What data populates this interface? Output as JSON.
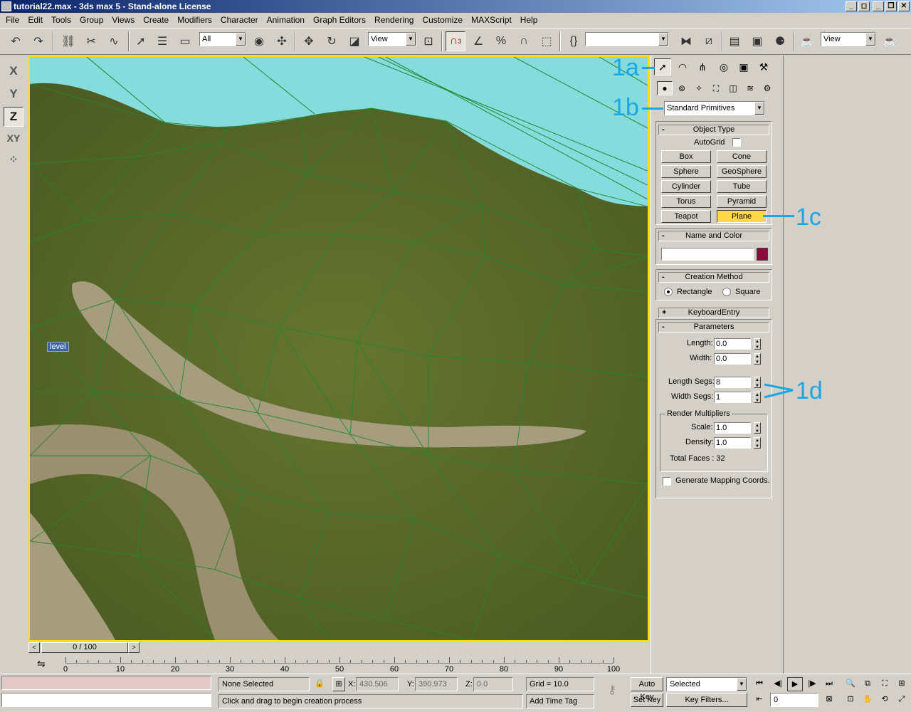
{
  "window": {
    "title": "tutorial22.max - 3ds max 5 - Stand-alone License",
    "btn_minimize": "_",
    "btn_restore1": "◻",
    "btn_min2": "_",
    "btn_restore2": "❐",
    "btn_close": "✕"
  },
  "menu": [
    "File",
    "Edit",
    "Tools",
    "Group",
    "Views",
    "Create",
    "Modifiers",
    "Character",
    "Animation",
    "Graph Editors",
    "Rendering",
    "Customize",
    "MAXScript",
    "Help"
  ],
  "toolbar": {
    "selection_filter": "All",
    "ref_coord": "View",
    "named_selection": "",
    "render_view": "View",
    "snap_label": "3"
  },
  "axis": {
    "x": "X",
    "y": "Y",
    "z": "Z",
    "xy": "XY"
  },
  "viewport": {
    "level_label": "level"
  },
  "timeslider": {
    "position": "0 / 100",
    "prev": "<",
    "next": ">"
  },
  "track_ticks": [
    "0",
    "10",
    "20",
    "30",
    "40",
    "50",
    "60",
    "70",
    "80",
    "90",
    "100"
  ],
  "command_panel": {
    "dropdown": "Standard Primitives",
    "object_type": {
      "header": "Object Type",
      "autogrid": "AutoGrid",
      "buttons": [
        "Box",
        "Cone",
        "Sphere",
        "GeoSphere",
        "Cylinder",
        "Tube",
        "Torus",
        "Pyramid",
        "Teapot",
        "Plane"
      ],
      "selected": "Plane"
    },
    "name_color": {
      "header": "Name and Color",
      "name_value": "",
      "color": "#8c0a3c"
    },
    "creation_method": {
      "header": "Creation Method",
      "rectangle": "Rectangle",
      "square": "Square",
      "selected": "Rectangle"
    },
    "keyboard_entry": {
      "header": "KeyboardEntry"
    },
    "parameters": {
      "header": "Parameters",
      "length_label": "Length:",
      "length_value": "0.0",
      "width_label": "Width:",
      "width_value": "0.0",
      "length_segs_label": "Length Segs:",
      "length_segs_value": "8",
      "width_segs_label": "Width Segs:",
      "width_segs_value": "1",
      "render_multipliers": "Render Multipliers",
      "scale_label": "Scale:",
      "scale_value": "1.0",
      "density_label": "Density:",
      "density_value": "1.0",
      "total_faces": "Total Faces : 32",
      "gen_mapping": "Generate Mapping Coords."
    },
    "minus": "-",
    "plus": "+"
  },
  "annotations": {
    "a": "1a",
    "b": "1b",
    "c": "1c",
    "d": "1d"
  },
  "statusbar": {
    "selection": "None Selected",
    "x_label": "X:",
    "x_value": "430.506",
    "y_label": "Y:",
    "y_value": "390.973",
    "z_label": "Z:",
    "z_value": "0.0",
    "grid": "Grid = 10.0",
    "prompt": "Click and drag to begin creation process",
    "add_time_tag": "Add Time Tag",
    "auto_key": "Auto Key",
    "set_key": "Set Key",
    "key_mode": "Selected",
    "key_filters": "Key Filters...",
    "frame": "0"
  },
  "colors": {
    "accent_annotation": "#1aa7e6",
    "viewport_border": "#ffe000",
    "sky": "#86dcdc",
    "terrain": "#5b6a2a"
  }
}
